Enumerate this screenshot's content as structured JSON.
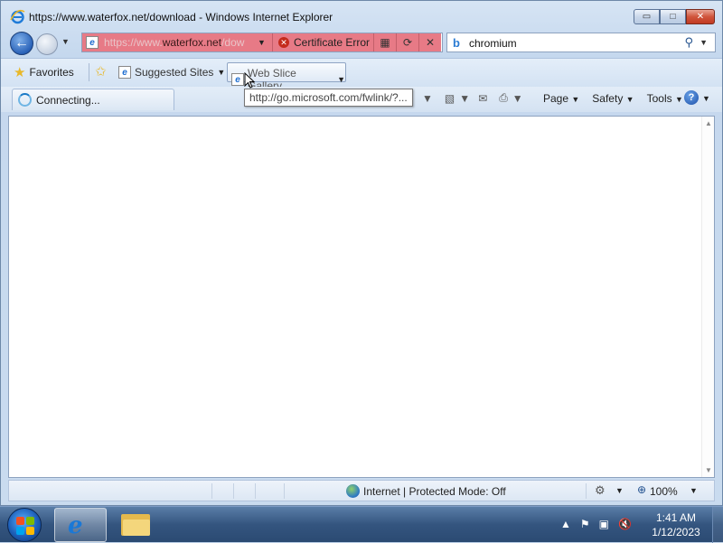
{
  "window": {
    "title": "https://www.waterfox.net/download - Windows Internet Explorer",
    "minimize_label": "▭",
    "maximize_label": "□",
    "close_label": "✕"
  },
  "address": {
    "url_prefix": "https://www.",
    "url_domain": "waterfox.net",
    "url_suffix": "/dow",
    "cert_error_label": "Certificate Error"
  },
  "search": {
    "query": "chromium"
  },
  "favorites_bar": {
    "favorites_label": "Favorites",
    "suggested_sites_label": "Suggested Sites",
    "web_slice_label": "Web Slice Gallery"
  },
  "tab": {
    "label": "Connecting..."
  },
  "command_bar": {
    "page_label": "Page",
    "safety_label": "Safety",
    "tools_label": "Tools"
  },
  "tooltip": {
    "text": "http://go.microsoft.com/fwlink/?..."
  },
  "status_bar": {
    "zone_text": "Internet | Protected Mode: Off",
    "zoom_text": "100%"
  },
  "taskbar": {
    "time": "1:41 AM",
    "date": "1/12/2023"
  },
  "colors": {
    "cert_error_bg": "#e77a86",
    "accent": "#2a62b8"
  }
}
